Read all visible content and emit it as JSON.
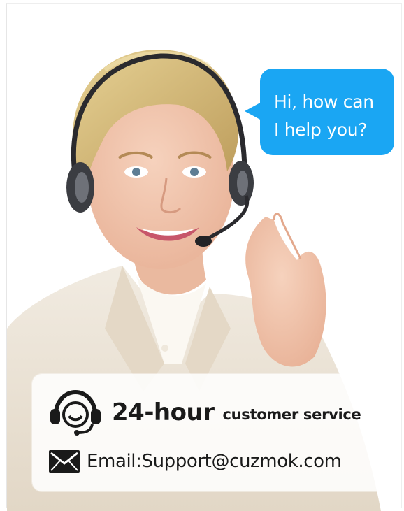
{
  "bubble": {
    "line1": "Hi, how can",
    "line2": "I help you?",
    "color": "#1aa6f3"
  },
  "service": {
    "hours": "24-hour",
    "label": "customer service",
    "icon": "headset-icon"
  },
  "contact": {
    "email_text": "Email:Support@cuzmok.com",
    "icon": "mail-icon"
  },
  "colors": {
    "text": "#1a1a1a",
    "panel": "#ffffff",
    "jacket": "#ece3d6",
    "hair": "#d9c07e"
  }
}
